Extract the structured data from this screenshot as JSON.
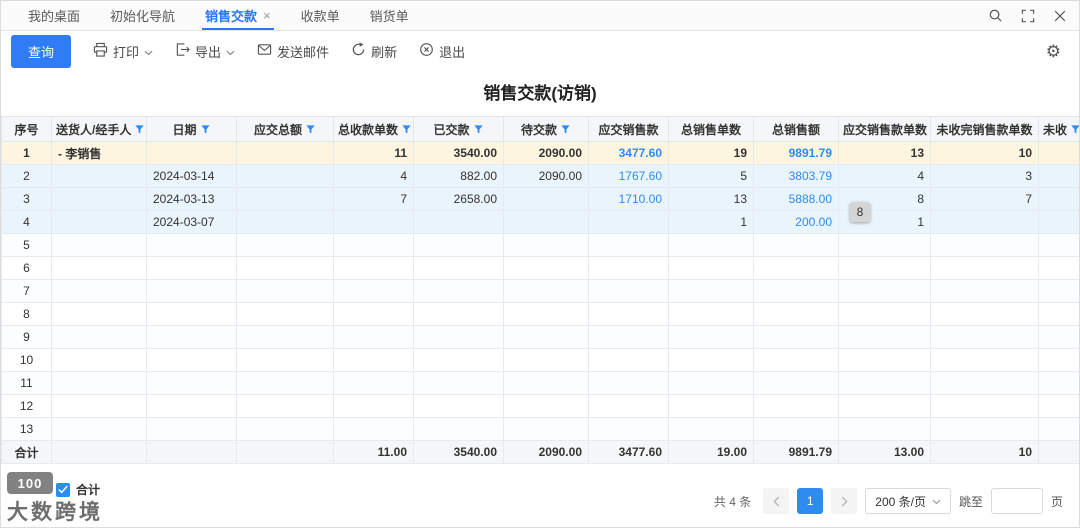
{
  "window": {
    "tabs": [
      {
        "label": "我的桌面",
        "active": false,
        "closable": false
      },
      {
        "label": "初始化导航",
        "active": false,
        "closable": false
      },
      {
        "label": "销售交款",
        "active": true,
        "closable": true
      },
      {
        "label": "收款单",
        "active": false,
        "closable": false
      },
      {
        "label": "销货单",
        "active": false,
        "closable": false
      }
    ]
  },
  "toolbar": {
    "query_label": "查询",
    "print_label": "打印",
    "export_label": "导出",
    "email_label": "发送邮件",
    "refresh_label": "刷新",
    "exit_label": "退出"
  },
  "page": {
    "title": "销售交款(访销)"
  },
  "table": {
    "columns": [
      {
        "key": "seq",
        "label": "序号",
        "width": 50,
        "align": "center",
        "sortable": false
      },
      {
        "key": "handler",
        "label": "送货人/经手人",
        "width": 95,
        "align": "left",
        "sortable": true
      },
      {
        "key": "date",
        "label": "日期",
        "width": 90,
        "align": "left",
        "sortable": true
      },
      {
        "key": "total_due",
        "label": "应交总额",
        "width": 97,
        "align": "right",
        "sortable": true
      },
      {
        "key": "receipt_count",
        "label": "总收款单数",
        "width": 80,
        "align": "right",
        "sortable": true
      },
      {
        "key": "paid",
        "label": "已交款",
        "width": 90,
        "align": "right",
        "sortable": true
      },
      {
        "key": "pending",
        "label": "待交款",
        "width": 85,
        "align": "right",
        "sortable": true
      },
      {
        "key": "sales_due",
        "label": "应交销售款",
        "width": 80,
        "align": "right",
        "sortable": false,
        "blue": true
      },
      {
        "key": "sales_orders",
        "label": "总销售单数",
        "width": 85,
        "align": "right",
        "sortable": false
      },
      {
        "key": "total_sales",
        "label": "总销售额",
        "width": 85,
        "align": "right",
        "sortable": false,
        "blue": true
      },
      {
        "key": "sales_due_count",
        "label": "应交销售款单数",
        "width": 92,
        "align": "right",
        "sortable": false
      },
      {
        "key": "unpaid_count",
        "label": "未收完销售款单数",
        "width": 108,
        "align": "right",
        "sortable": false
      },
      {
        "key": "overflow",
        "label": "未收",
        "width": 43,
        "align": "right",
        "sortable": true
      }
    ],
    "rows": [
      {
        "style": "parent",
        "cells": {
          "seq": "1",
          "handler": "- 李销售",
          "receipt_count": "11",
          "paid": "3540.00",
          "pending": "2090.00",
          "sales_due": "3477.60",
          "sales_orders": "19",
          "total_sales": "9891.79",
          "sales_due_count": "13",
          "unpaid_count": "10"
        }
      },
      {
        "style": "child",
        "cells": {
          "seq": "2",
          "date": "2024-03-14",
          "receipt_count": "4",
          "paid": "882.00",
          "pending": "2090.00",
          "sales_due": "1767.60",
          "sales_orders": "5",
          "total_sales": "3803.79",
          "sales_due_count": "4",
          "unpaid_count": "3"
        }
      },
      {
        "style": "child",
        "cells": {
          "seq": "3",
          "date": "2024-03-13",
          "receipt_count": "7",
          "paid": "2658.00",
          "sales_due": "1710.00",
          "sales_orders": "13",
          "total_sales": "5888.00",
          "sales_due_count": "8",
          "unpaid_count": "7"
        }
      },
      {
        "style": "child",
        "cells": {
          "seq": "4",
          "date": "2024-03-07",
          "sales_orders": "1",
          "total_sales": "200.00",
          "sales_due_count": "1"
        }
      },
      {
        "style": "blank",
        "cells": {
          "seq": "5"
        }
      },
      {
        "style": "blank",
        "cells": {
          "seq": "6"
        }
      },
      {
        "style": "blank",
        "cells": {
          "seq": "7"
        }
      },
      {
        "style": "blank",
        "cells": {
          "seq": "8"
        }
      },
      {
        "style": "blank",
        "cells": {
          "seq": "9"
        }
      },
      {
        "style": "blank",
        "cells": {
          "seq": "10"
        }
      },
      {
        "style": "blank",
        "cells": {
          "seq": "11"
        }
      },
      {
        "style": "blank",
        "cells": {
          "seq": "12"
        }
      },
      {
        "style": "blank",
        "cells": {
          "seq": "13"
        }
      },
      {
        "style": "total",
        "cells": {
          "seq": "合计",
          "receipt_count": "11.00",
          "paid": "3540.00",
          "pending": "2090.00",
          "sales_due": "3477.60",
          "sales_orders": "19.00",
          "total_sales": "9891.79",
          "sales_due_count": "13.00",
          "unpaid_count": "10"
        }
      }
    ],
    "floating_badge": "8"
  },
  "footer": {
    "summary_label": "合计",
    "total_count_label": "共 4 条",
    "current_page": "1",
    "page_size_label": "200 条/页",
    "jump_label": "跳至",
    "page_unit_label": "页"
  },
  "watermark": {
    "text": "大数跨境",
    "logo_text": "100"
  },
  "colors": {
    "accent": "#2878ff",
    "link_number": "#2d8cf0",
    "selected_row": "#fdf5df",
    "child_row": "#e9f4fd"
  }
}
